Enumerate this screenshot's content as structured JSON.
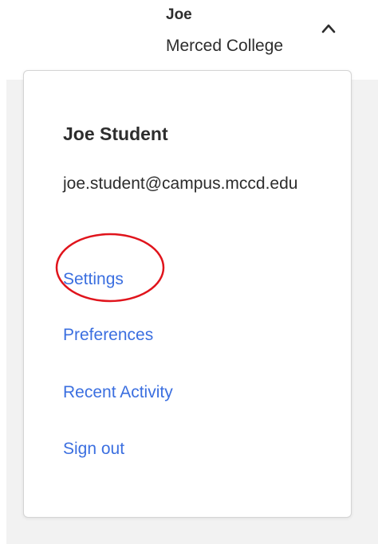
{
  "account": {
    "name": "Joe",
    "org": "Merced College",
    "chevron_icon": "chevron-up-icon"
  },
  "dropdown": {
    "full_name": "Joe Student",
    "email": "joe.student@campus.mccd.edu",
    "links": {
      "settings": "Settings",
      "preferences": "Preferences",
      "recent_activity": "Recent Activity",
      "sign_out": "Sign out"
    }
  },
  "colors": {
    "link": "#3b6fe0",
    "text": "#2d2d2d",
    "annotation": "#e0141c",
    "backdrop": "#f2f2f2"
  }
}
